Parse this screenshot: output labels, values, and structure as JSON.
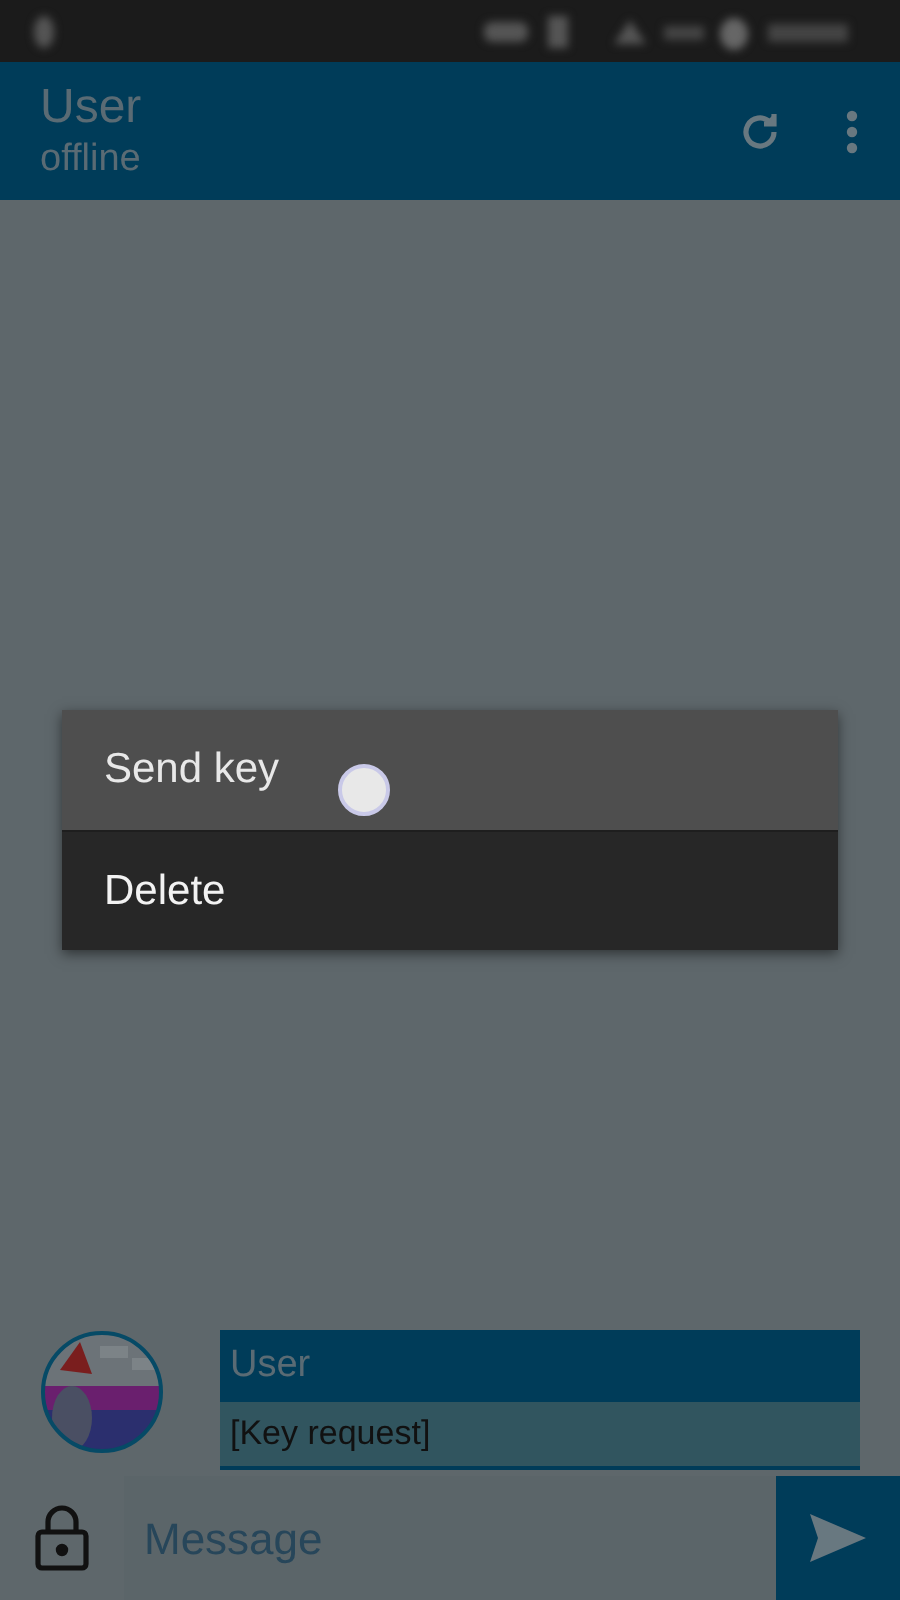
{
  "app_bar": {
    "title": "User",
    "subtitle": "offline"
  },
  "messages": [
    {
      "sender": "User",
      "text": "[Key request]"
    }
  ],
  "composer": {
    "placeholder": "Message"
  },
  "context_menu": {
    "items": [
      {
        "label": "Send key",
        "selected": true
      },
      {
        "label": "Delete",
        "selected": false
      }
    ]
  }
}
